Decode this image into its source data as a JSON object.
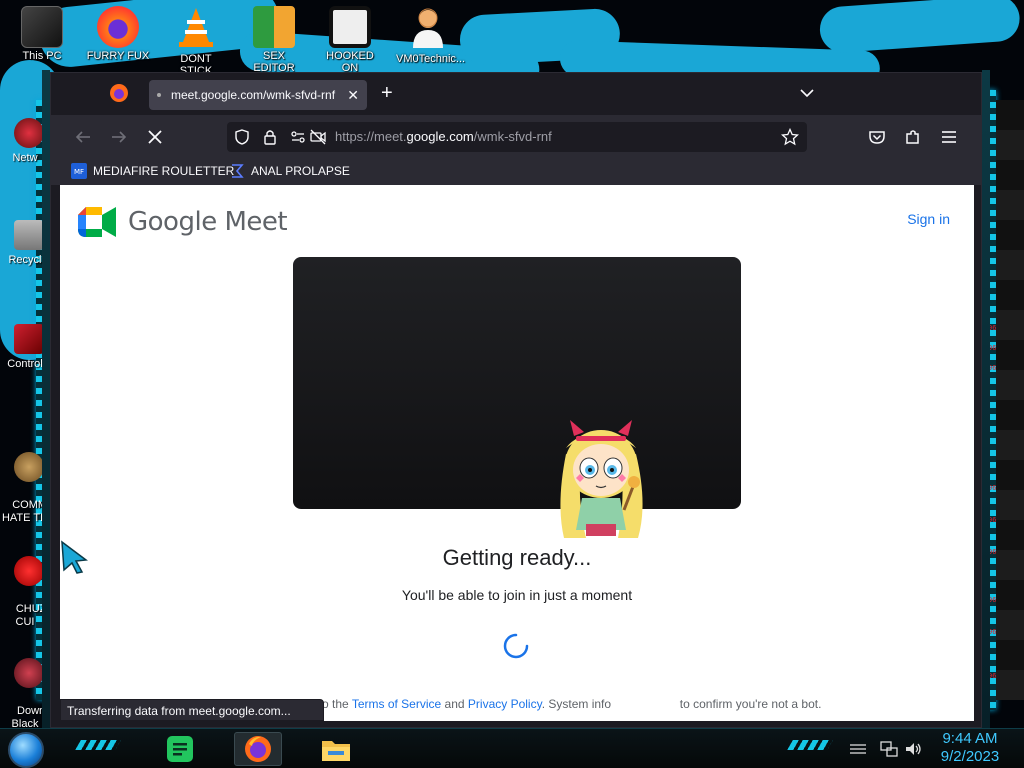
{
  "desktop": {
    "top_icons": [
      {
        "label": "This PC"
      },
      {
        "label": "FURRY FUX"
      },
      {
        "label": "DONT STICK"
      },
      {
        "label": "SEX EDITOR"
      },
      {
        "label": "HOOKED ON"
      },
      {
        "label": "VM0Technic..."
      }
    ],
    "left_icons": [
      {
        "label": "Netw"
      },
      {
        "label": "Recycl"
      },
      {
        "label": "Control"
      },
      {
        "label": "COMMU\nHATE TH"
      },
      {
        "label": "CHUZ\nCUI"
      },
      {
        "label": "Down\nBlack"
      }
    ],
    "right_ticks": [
      "96",
      "96",
      "96",
      "96",
      "96",
      "96",
      "96",
      "96",
      "96"
    ]
  },
  "browser": {
    "tab": {
      "title": "meet.google.com/wmk-sfvd-rnf",
      "close_glyph": "✕"
    },
    "new_tab_glyph": "+",
    "url": {
      "prefix": "https://meet.",
      "domain": "google.com",
      "path": "/wmk-sfvd-rnf"
    },
    "bookmarks": [
      {
        "label": "MEDIAFIRE ROULETTER"
      },
      {
        "label": "ANAL PROLAPSE"
      }
    ]
  },
  "page": {
    "brand": {
      "google": "Google",
      "meet": "Meet"
    },
    "sign_in": "Sign in",
    "heading": "Getting ready...",
    "subheading": "You'll be able to join in just a moment",
    "legal": {
      "before": "o the",
      "terms": "Terms of Service",
      "and": "and",
      "privacy": "Privacy Policy",
      "mid": ". System info",
      "after": "to confirm you're not a bot."
    },
    "status_tip": "Transferring data from meet.google.com..."
  },
  "taskbar": {
    "time": "9:44 AM",
    "date": "9/2/2023"
  },
  "colors": {
    "accent_cyan": "#1aa7d6",
    "link_blue": "#1a73e8",
    "clock_blue": "#3fc9ff",
    "firefox_dark": "#1c1b22"
  }
}
